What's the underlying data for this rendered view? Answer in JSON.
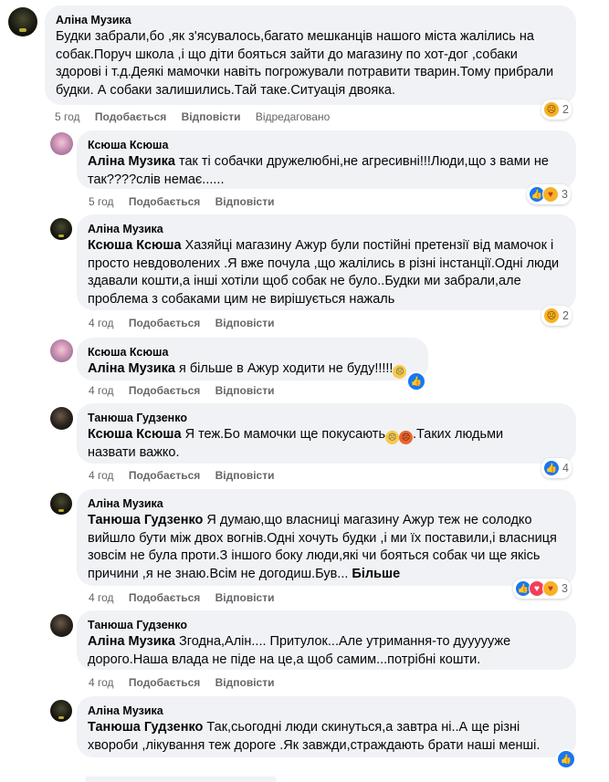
{
  "comments": [
    {
      "author": "Аліна Музика",
      "mention": "",
      "text": "Будки забрали,бо ,як з'ясувалось,багато мешканців нашого міста жалілись на собак.Поруч школа ,і що діти бояться зайти до магазину по хот-дог ,собаки здорові і т.д.Деякі мамочки навіть погрожували потравити тварин.Тому прибрали будки. А собаки залишились.Тай таке.Ситуація двояка.",
      "time": "5 год",
      "like": "Подобається",
      "reply": "Відповісти",
      "edited": "Відредаговано",
      "reaction_count": "2",
      "reaction_icons": [
        "sad-reaction-icon"
      ]
    },
    {
      "author": "Ксюша Ксюша",
      "mention": "Аліна Музика",
      "text": " так ті собачки дружелюбні,не агресивні!!!Люди,що з вами не так????слів немає......",
      "time": "5 год",
      "like": "Подобається",
      "reply": "Відповісти",
      "reaction_count": "3",
      "reaction_icons": [
        "like-reaction-icon",
        "care-reaction-icon"
      ]
    },
    {
      "author": "Аліна Музика",
      "mention": "Ксюша Ксюша",
      "text": " Хазяйці магазину Ажур були постійні претензії від мамочок і просто невдоволених .Я вже почула ,що жалілись в різні інстанції.Одні люди здавали кошти,а інші хотіли щоб собак не було..Будки ми забрали,але проблема з собаками цим не вирішується нажаль",
      "time": "4 год",
      "like": "Подобається",
      "reply": "Відповісти",
      "reaction_count": "2",
      "reaction_icons": [
        "sad-reaction-icon"
      ]
    },
    {
      "author": "Ксюша Ксюша",
      "mention": "Аліна Музика",
      "text": " я більше в Ажур ходити не буду!!!!!",
      "time": "4 год",
      "like": "Подобається",
      "reply": "Відповісти"
    },
    {
      "author": "Танюша Гудзенко",
      "mention": "Ксюша Ксюша",
      "text": " Я теж.Бо мамочки ще покусають",
      "text_after": ".Таких людьми назвати важко.",
      "time": "4 год",
      "like": "Подобається",
      "reply": "Відповісти",
      "reaction_count": "4",
      "reaction_icons": [
        "like-reaction-icon"
      ]
    },
    {
      "author": "Аліна Музика",
      "mention": "Танюша Гудзенко",
      "text": " Я думаю,що власниці магазину Ажур теж не солодко вийшло бути між двох вогнів.Одні хочуть будки ,і ми їх поставили,і власниця зовсім не була проти.З іншого боку люди,які чи бояться собак чи ще якісь причини ,я не знаю.Всім не догодиш.Був... ",
      "more": "Більше",
      "time": "4 год",
      "like": "Подобається",
      "reply": "Відповісти",
      "reaction_count": "3",
      "reaction_icons": [
        "like-reaction-icon",
        "love-reaction-icon",
        "care-reaction-icon"
      ]
    },
    {
      "author": "Танюша Гудзенко",
      "mention": "Аліна Музика",
      "text": " Згодна,Алін.... Притулок...Але утримання-то дуууууже дорого.Наша влада не піде на це,а щоб самим...потрібні кошти.",
      "time": "4 год",
      "like": "Подобається",
      "reply": "Відповісти"
    },
    {
      "author": "Аліна Музика",
      "mention": "Танюша Гудзенко",
      "text": " Так,сьогодні люди скинуться,а завтра ні..А ще різні хвороби ,лікування теж дороге .Як завжди,страждають брати наші менші.",
      "time": "",
      "like": "",
      "reply": ""
    }
  ],
  "colors": {
    "bubble": "#f0f2f5",
    "meta": "#65676b",
    "like": "#1877f2"
  }
}
